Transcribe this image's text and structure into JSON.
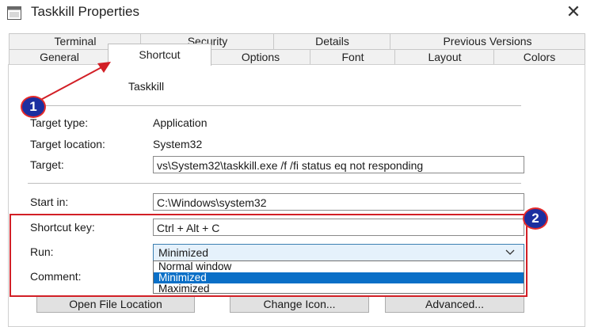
{
  "window": {
    "title": "Taskkill Properties",
    "close_glyph": "✕"
  },
  "tabs_row1": [
    "Terminal",
    "Security",
    "Details",
    "Previous Versions"
  ],
  "tabs_row2": [
    "General",
    "Shortcut",
    "Options",
    "Font",
    "Layout",
    "Colors"
  ],
  "shortcut_name": "Taskkill",
  "fields": {
    "target_type": {
      "label": "Target type:",
      "value": "Application"
    },
    "target_location": {
      "label": "Target location:",
      "value": "System32"
    },
    "target": {
      "label": "Target:",
      "value": "vs\\System32\\taskkill.exe /f /fi status eq not responding"
    },
    "start_in": {
      "label": "Start in:",
      "value": "C:\\Windows\\system32"
    },
    "shortcut_key": {
      "label": "Shortcut key:",
      "value": "Ctrl + Alt + C"
    },
    "run": {
      "label": "Run:",
      "selected": "Minimized",
      "options": [
        "Normal window",
        "Minimized",
        "Maximized"
      ]
    },
    "comment": {
      "label": "Comment:"
    }
  },
  "buttons": {
    "open_file_location": "Open File Location",
    "change_icon": "Change Icon...",
    "advanced": "Advanced..."
  },
  "annotations": {
    "badge1": "1",
    "badge2": "2",
    "color": "#d21f26",
    "badge_fill": "#1c2fa0"
  }
}
